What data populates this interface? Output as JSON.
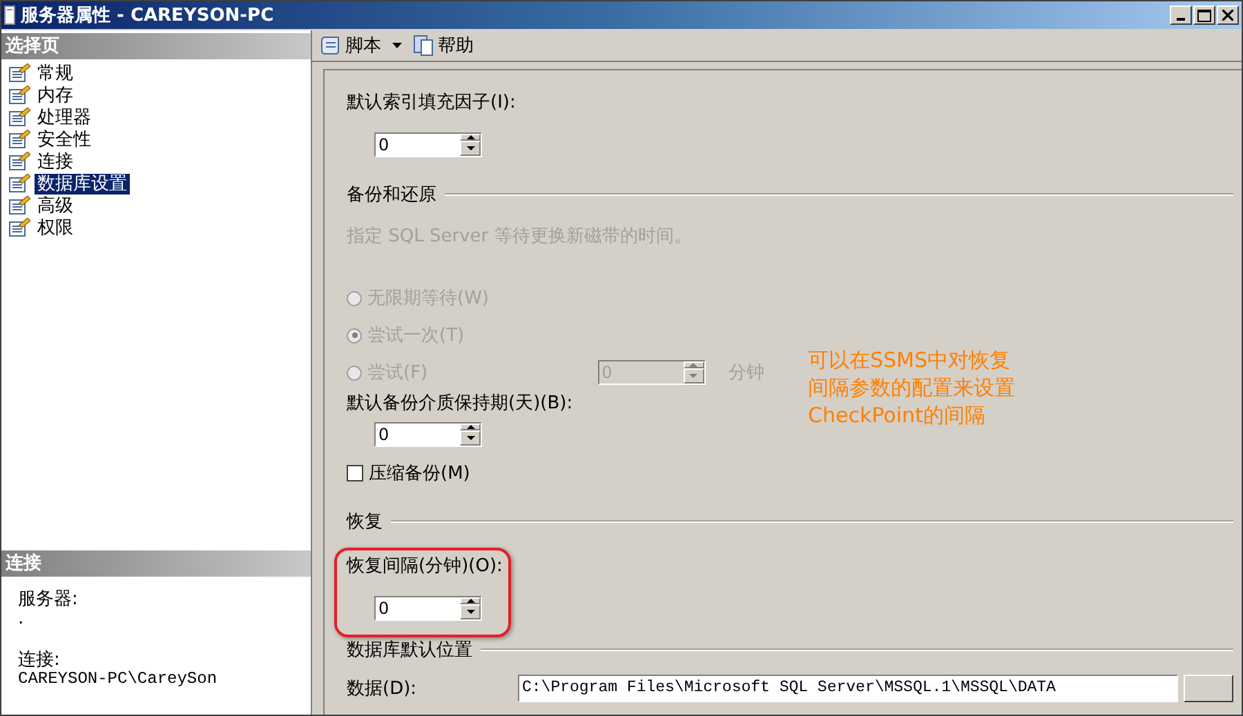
{
  "window": {
    "title": "服务器属性 - CAREYSON-PC"
  },
  "sidebar": {
    "heading": "选择页",
    "items": [
      {
        "label": "常规",
        "selected": false
      },
      {
        "label": "内存",
        "selected": false
      },
      {
        "label": "处理器",
        "selected": false
      },
      {
        "label": "安全性",
        "selected": false
      },
      {
        "label": "连接",
        "selected": false
      },
      {
        "label": "数据库设置",
        "selected": true
      },
      {
        "label": "高级",
        "selected": false
      },
      {
        "label": "权限",
        "selected": false
      }
    ],
    "connection": {
      "heading": "连接",
      "server_label": "服务器:",
      "server_value": ".",
      "connection_label": "连接:",
      "connection_value": "CAREYSON-PC\\CareySon"
    }
  },
  "toolbar": {
    "items": [
      {
        "label": "脚本",
        "kind": "dropdown"
      },
      {
        "label": "帮助",
        "kind": "help"
      }
    ]
  },
  "form": {
    "fill_factor": {
      "label": "默认索引填充因子(I):",
      "value": "0"
    },
    "backup_section": {
      "title": "备份和还原",
      "hint": "指定 SQL Server 等待更换新磁带的时间。",
      "options": [
        {
          "label": "无限期等待(W)",
          "selected": false,
          "disabled": true
        },
        {
          "label": "尝试一次(T)",
          "selected": true,
          "disabled": true
        },
        {
          "label": "尝试(F)",
          "selected": false,
          "disabled": true
        }
      ],
      "minutes": {
        "value": "0",
        "unit": "分钟",
        "disabled": true
      },
      "retention": {
        "label": "默认备份介质保持期(天)(B):",
        "value": "0"
      },
      "compress": {
        "label": "压缩备份(M)",
        "checked": false
      }
    },
    "recovery_section": {
      "title": "恢复",
      "interval": {
        "label": "恢复间隔(分钟)(O):",
        "value": "0"
      }
    },
    "locations_section": {
      "title": "数据库默认位置",
      "data": {
        "label": "数据(D):",
        "value": "C:\\Program Files\\Microsoft SQL Server\\MSSQL.1\\MSSQL\\DATA"
      }
    }
  },
  "annotation": {
    "text": "可以在SSMS中对恢复间隔参数的配置来设置CheckPoint的间隔"
  }
}
